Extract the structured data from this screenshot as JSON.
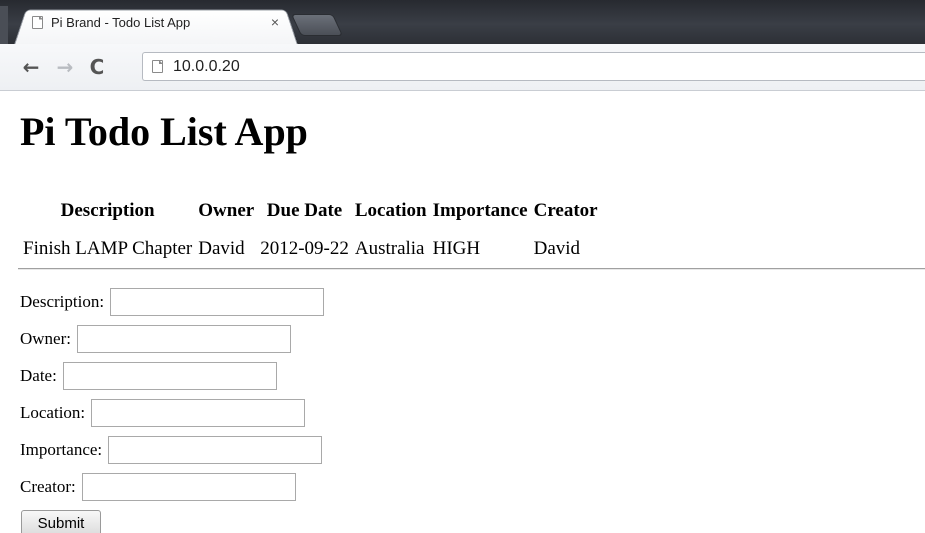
{
  "browser": {
    "tab_title": "Pi Brand - Todo List App",
    "tab_close": "×",
    "url": "10.0.0.20",
    "back_icon": "←",
    "forward_icon": "→",
    "reload_icon": "C"
  },
  "page": {
    "title": "Pi Todo List App"
  },
  "table": {
    "headers": [
      "Description",
      "Owner",
      "Due Date",
      "Location",
      "Importance",
      "Creator"
    ],
    "rows": [
      [
        "Finish LAMP Chapter",
        "David",
        "2012-09-22",
        "Australia",
        "HIGH",
        "David"
      ]
    ]
  },
  "form": {
    "fields": [
      {
        "label": "Description:",
        "value": ""
      },
      {
        "label": "Owner:",
        "value": ""
      },
      {
        "label": "Date:",
        "value": ""
      },
      {
        "label": "Location:",
        "value": ""
      },
      {
        "label": "Importance:",
        "value": ""
      },
      {
        "label": "Creator:",
        "value": ""
      }
    ],
    "submit_label": "Submit"
  }
}
